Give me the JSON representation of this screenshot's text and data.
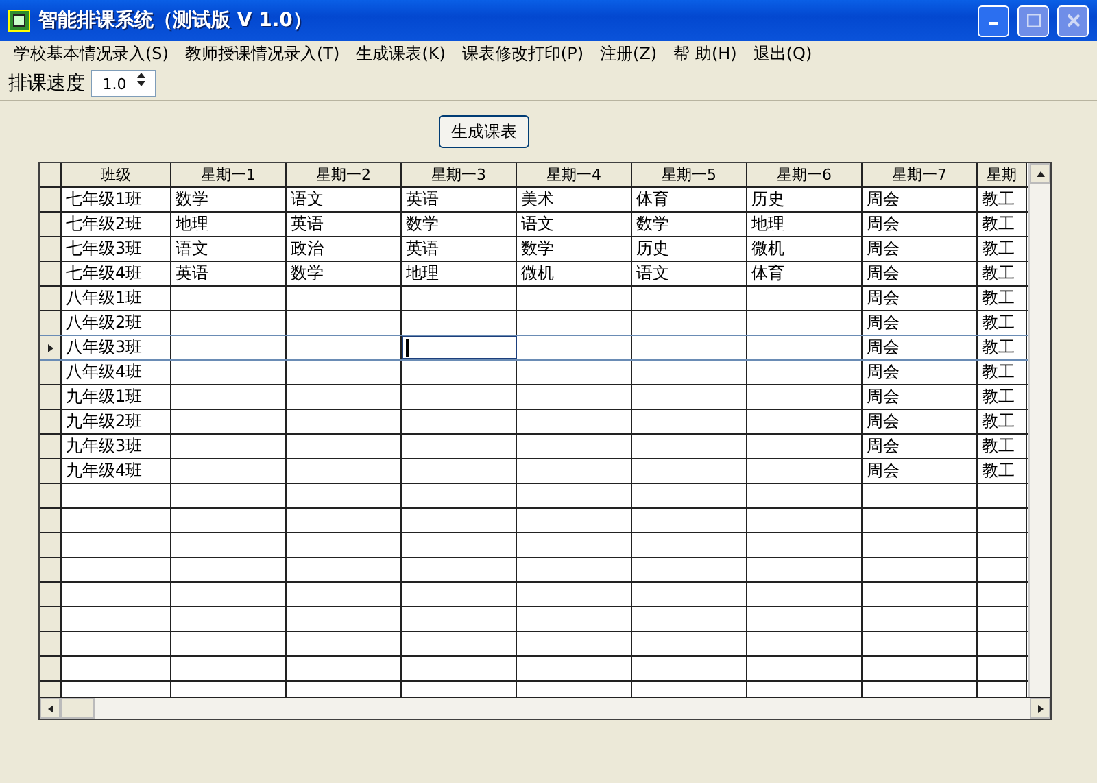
{
  "window": {
    "title": "智能排课系统（测试版 V 1.0）"
  },
  "menu": [
    "学校基本情况录入(S)",
    "教师授课情况录入(T)",
    "生成课表(K)",
    "课表修改打印(P)",
    "注册(Z)",
    "帮 助(H)",
    "退出(Q)"
  ],
  "toolbar": {
    "label": "排课速度",
    "speed": "1.0"
  },
  "generate_button": "生成课表",
  "table": {
    "columns": [
      "班级",
      "星期一1",
      "星期一2",
      "星期一3",
      "星期一4",
      "星期一5",
      "星期一6",
      "星期一7",
      "星期"
    ],
    "rows": [
      {
        "selected": false,
        "cells": [
          {
            "text": "七年级1班",
            "focused": false
          },
          {
            "text": "数学",
            "focused": false
          },
          {
            "text": "语文",
            "focused": false
          },
          {
            "text": "英语",
            "focused": false
          },
          {
            "text": "美术",
            "focused": false
          },
          {
            "text": "体育",
            "focused": false
          },
          {
            "text": "历史",
            "focused": false
          },
          {
            "text": "周会",
            "focused": false
          },
          {
            "text": "教工",
            "focused": false
          }
        ]
      },
      {
        "selected": false,
        "cells": [
          {
            "text": "七年级2班",
            "focused": false
          },
          {
            "text": "地理",
            "focused": false
          },
          {
            "text": "英语",
            "focused": false
          },
          {
            "text": "数学",
            "focused": false
          },
          {
            "text": "语文",
            "focused": false
          },
          {
            "text": "数学",
            "focused": false
          },
          {
            "text": "地理",
            "focused": false
          },
          {
            "text": "周会",
            "focused": false
          },
          {
            "text": "教工",
            "focused": false
          }
        ]
      },
      {
        "selected": false,
        "cells": [
          {
            "text": "七年级3班",
            "focused": false
          },
          {
            "text": "语文",
            "focused": false
          },
          {
            "text": "政治",
            "focused": false
          },
          {
            "text": "英语",
            "focused": false
          },
          {
            "text": "数学",
            "focused": false
          },
          {
            "text": "历史",
            "focused": false
          },
          {
            "text": "微机",
            "focused": false
          },
          {
            "text": "周会",
            "focused": false
          },
          {
            "text": "教工",
            "focused": false
          }
        ]
      },
      {
        "selected": false,
        "cells": [
          {
            "text": "七年级4班",
            "focused": false
          },
          {
            "text": "英语",
            "focused": false
          },
          {
            "text": "数学",
            "focused": false
          },
          {
            "text": "地理",
            "focused": false
          },
          {
            "text": "微机",
            "focused": false
          },
          {
            "text": "语文",
            "focused": false
          },
          {
            "text": "体育",
            "focused": false
          },
          {
            "text": "周会",
            "focused": false
          },
          {
            "text": "教工",
            "focused": false
          }
        ]
      },
      {
        "selected": false,
        "cells": [
          {
            "text": "八年级1班",
            "focused": false
          },
          {
            "focused": false
          },
          {
            "focused": false
          },
          {
            "focused": false
          },
          {
            "focused": false
          },
          {
            "focused": false
          },
          {
            "focused": false
          },
          {
            "text": "周会",
            "focused": false
          },
          {
            "text": "教工",
            "focused": false
          }
        ]
      },
      {
        "selected": false,
        "cells": [
          {
            "text": "八年级2班",
            "focused": false
          },
          {
            "focused": false
          },
          {
            "focused": false
          },
          {
            "focused": false
          },
          {
            "focused": false
          },
          {
            "focused": false
          },
          {
            "focused": false
          },
          {
            "text": "周会",
            "focused": false
          },
          {
            "text": "教工",
            "focused": false
          }
        ]
      },
      {
        "selected": true,
        "cells": [
          {
            "text": "八年级3班",
            "focused": false
          },
          {
            "focused": false
          },
          {
            "focused": false
          },
          {
            "focused": true
          },
          {
            "focused": false
          },
          {
            "focused": false
          },
          {
            "focused": false
          },
          {
            "text": "周会",
            "focused": false
          },
          {
            "text": "教工",
            "focused": false
          }
        ]
      },
      {
        "selected": false,
        "cells": [
          {
            "text": "八年级4班",
            "focused": false
          },
          {
            "focused": false
          },
          {
            "focused": false
          },
          {
            "focused": false
          },
          {
            "focused": false
          },
          {
            "focused": false
          },
          {
            "focused": false
          },
          {
            "text": "周会",
            "focused": false
          },
          {
            "text": "教工",
            "focused": false
          }
        ]
      },
      {
        "selected": false,
        "cells": [
          {
            "text": "九年级1班",
            "focused": false
          },
          {
            "focused": false
          },
          {
            "focused": false
          },
          {
            "focused": false
          },
          {
            "focused": false
          },
          {
            "focused": false
          },
          {
            "focused": false
          },
          {
            "text": "周会",
            "focused": false
          },
          {
            "text": "教工",
            "focused": false
          }
        ]
      },
      {
        "selected": false,
        "cells": [
          {
            "text": "九年级2班",
            "focused": false
          },
          {
            "focused": false
          },
          {
            "focused": false
          },
          {
            "focused": false
          },
          {
            "focused": false
          },
          {
            "focused": false
          },
          {
            "focused": false
          },
          {
            "text": "周会",
            "focused": false
          },
          {
            "text": "教工",
            "focused": false
          }
        ]
      },
      {
        "selected": false,
        "cells": [
          {
            "text": "九年级3班",
            "focused": false
          },
          {
            "focused": false
          },
          {
            "focused": false
          },
          {
            "focused": false
          },
          {
            "focused": false
          },
          {
            "focused": false
          },
          {
            "focused": false
          },
          {
            "text": "周会",
            "focused": false
          },
          {
            "text": "教工",
            "focused": false
          }
        ]
      },
      {
        "selected": false,
        "cells": [
          {
            "text": "九年级4班",
            "focused": false
          },
          {
            "focused": false
          },
          {
            "focused": false
          },
          {
            "focused": false
          },
          {
            "focused": false
          },
          {
            "focused": false
          },
          {
            "focused": false
          },
          {
            "text": "周会",
            "focused": false
          },
          {
            "text": "教工",
            "focused": false
          }
        ]
      }
    ]
  }
}
